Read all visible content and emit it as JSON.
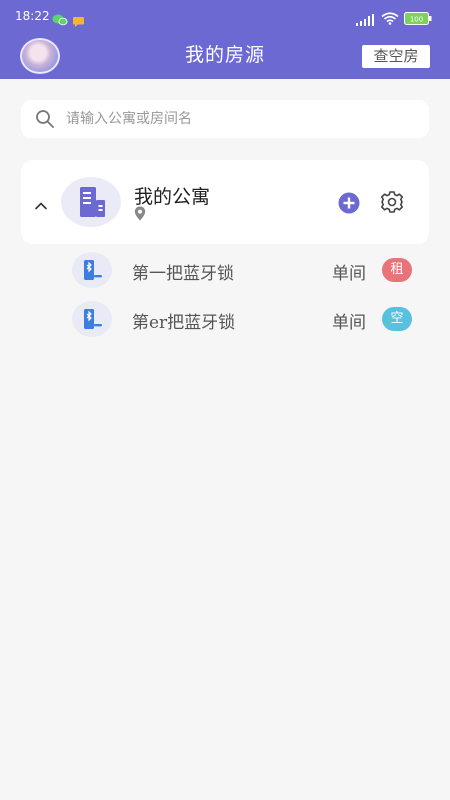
{
  "status_bar": {
    "time": "18:22",
    "battery": "100"
  },
  "header": {
    "title": "我的房源",
    "check_button": "查空房"
  },
  "search": {
    "placeholder": "请输入公寓或房间名",
    "value": ""
  },
  "apartment": {
    "name": "我的公寓",
    "expanded": true
  },
  "locks": [
    {
      "name": "第一把蓝牙锁",
      "type": "单间",
      "status": "租",
      "status_color": "#e8747a"
    },
    {
      "name": "第er把蓝牙锁",
      "type": "单间",
      "status": "空",
      "status_color": "#5ac0e0"
    }
  ],
  "colors": {
    "primary": "#6c6ad2",
    "background": "#f6f6f6"
  },
  "icons": [
    "wechat-icon",
    "message-icon",
    "signal-icon",
    "wifi-icon",
    "battery-icon",
    "search-icon",
    "chevron-up-icon",
    "building-icon",
    "location-pin-icon",
    "add-circle-icon",
    "gear-icon",
    "bluetooth-lock-icon"
  ]
}
